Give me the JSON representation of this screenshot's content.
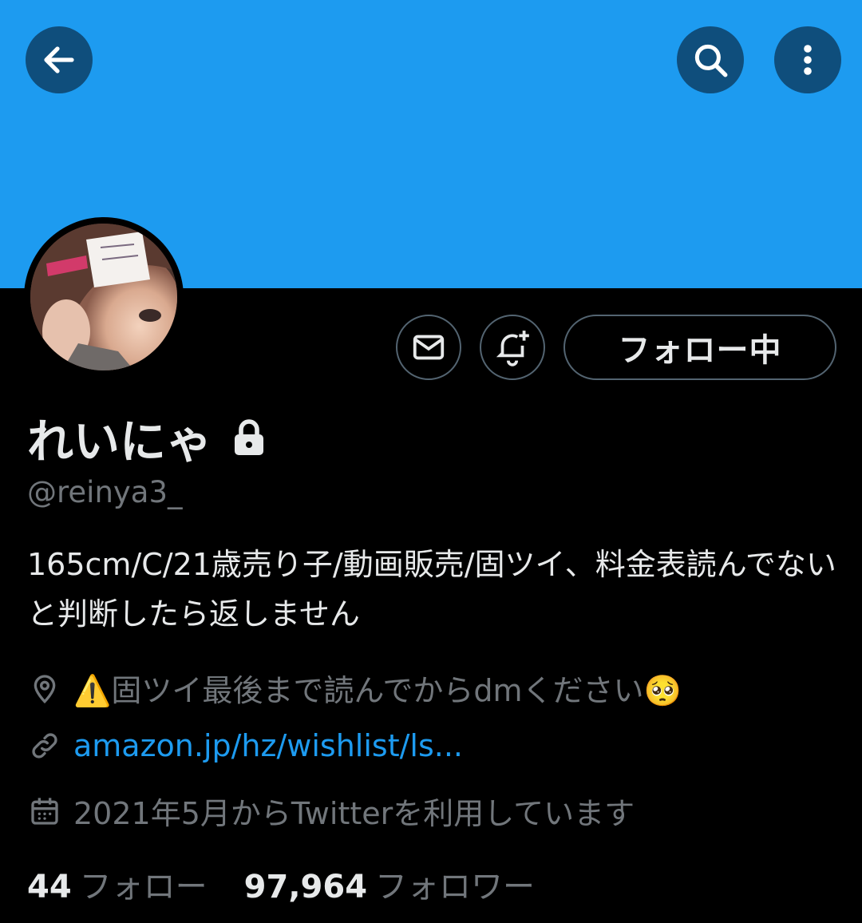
{
  "header": {
    "back_icon": "arrow-left-icon",
    "search_icon": "search-icon",
    "more_icon": "more-vertical-icon",
    "banner_color": "#1d9bf0"
  },
  "actions": {
    "message_icon": "envelope-icon",
    "notify_icon": "bell-plus-icon",
    "follow_label": "フォロー中"
  },
  "profile": {
    "name": "れいにゃ",
    "protected_icon": "lock-icon",
    "handle": "@reinya3_",
    "bio": "165cm/C/21歳売り子/動画販売/固ツイ、料金表読んでないと判断したら返しません",
    "location": "⚠️固ツイ最後まで読んでからdmください🥺",
    "website": "amazon.jp/hz/wishlist/ls...",
    "joined": "2021年5月からTwitterを利用しています"
  },
  "stats": {
    "following_count": "44",
    "following_label": "フォロー",
    "followers_count": "97,964",
    "followers_label": "フォロワー"
  },
  "colors": {
    "accent": "#1d9bf0",
    "muted": "#71767b",
    "text": "#e7e9ea",
    "background": "#000000"
  }
}
